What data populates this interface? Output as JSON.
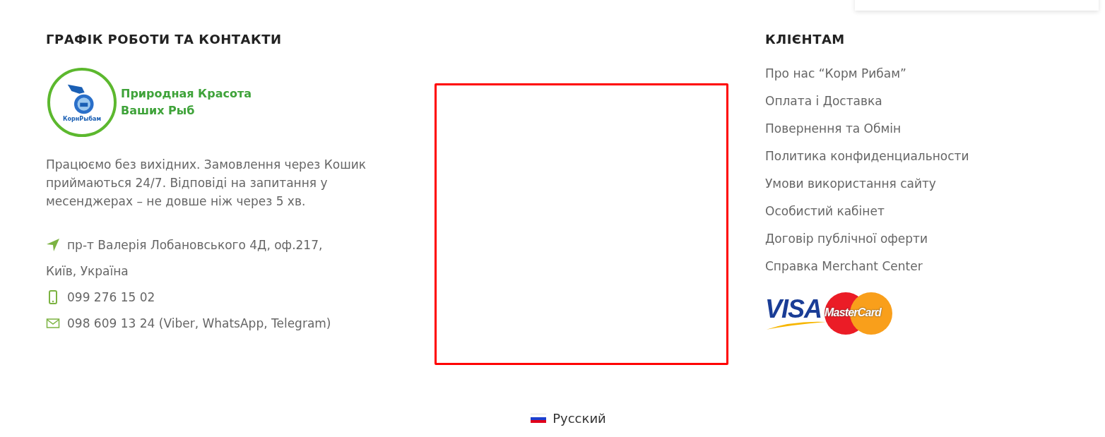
{
  "contacts": {
    "heading": "ГРАФІК РОБОТИ ТА КОНТАКТИ",
    "logo": {
      "badge": "КорнРыбам",
      "slogan_lines": [
        "Природная Красота",
        "Ваших Рыб"
      ]
    },
    "description": "Працюємо без вихідних. Замовлення через Кошик приймаються 24/7. Відповіді на запитання у месенджерах – не довше ніж через 5 хв.",
    "items": [
      {
        "kind": "address",
        "lines": [
          "пр-т Валерія Лобановського 4Д, оф.217,",
          "Київ, Україна"
        ]
      },
      {
        "kind": "phone",
        "lines": [
          "099 276 15 02"
        ]
      },
      {
        "kind": "mail",
        "lines": [
          "098 609 13 24 (Viber, WhatsApp, Telegram)"
        ]
      }
    ]
  },
  "clients": {
    "heading": "КЛІЄНТАМ",
    "links": [
      "Про нас “Корм Рибам”",
      "Оплата і Доставка",
      "Повернення та Обмін",
      "Политика конфиденциальности",
      "Умови використання сайту",
      "Особистий кабінет",
      "Договір публічної оферти",
      "Справка Merchant Center"
    ],
    "payment": {
      "visa": "VISA",
      "mastercard": "MasterCard"
    }
  },
  "language": {
    "label": "Русский"
  }
}
